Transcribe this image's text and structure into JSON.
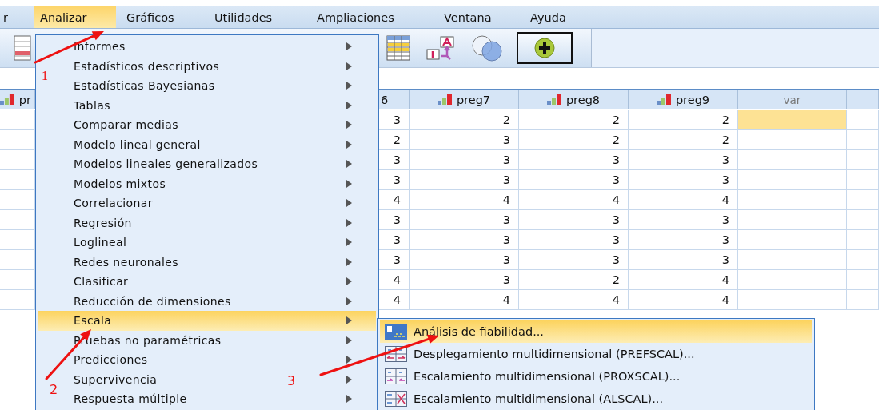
{
  "menu_bar": {
    "items": [
      {
        "label": "r",
        "selected": false
      },
      {
        "label": "Analizar",
        "selected": true
      },
      {
        "label": "Gráficos",
        "selected": false
      },
      {
        "label": "Utilidades",
        "selected": false
      },
      {
        "label": "Ampliaciones",
        "selected": false
      },
      {
        "label": "Ventana",
        "selected": false
      },
      {
        "label": "Ayuda",
        "selected": false
      }
    ]
  },
  "toolbar": {
    "buttons": [
      {
        "kind": "data-view",
        "pressed": false
      },
      {
        "kind": "grid",
        "pressed": false
      },
      {
        "kind": "value-labels",
        "pressed": false
      },
      {
        "kind": "sets",
        "pressed": false
      },
      {
        "kind": "plus",
        "pressed": true
      }
    ]
  },
  "grid": {
    "columns": [
      {
        "label": "pr",
        "kind": "variable"
      },
      {
        "label": "6",
        "kind": "plain"
      },
      {
        "label": "preg7",
        "kind": "variable"
      },
      {
        "label": "preg8",
        "kind": "variable"
      },
      {
        "label": "preg9",
        "kind": "variable"
      },
      {
        "label": "var",
        "kind": "empty"
      }
    ],
    "rows": [
      {
        "values": [
          "3",
          "2",
          "2",
          "2"
        ],
        "selected": true
      },
      {
        "values": [
          "2",
          "3",
          "2",
          "2"
        ],
        "selected": false
      },
      {
        "values": [
          "3",
          "3",
          "3",
          "3"
        ],
        "selected": false
      },
      {
        "values": [
          "3",
          "3",
          "3",
          "3"
        ],
        "selected": false
      },
      {
        "values": [
          "4",
          "4",
          "4",
          "4"
        ],
        "selected": false
      },
      {
        "values": [
          "3",
          "3",
          "3",
          "3"
        ],
        "selected": false
      },
      {
        "values": [
          "3",
          "3",
          "3",
          "3"
        ],
        "selected": false
      },
      {
        "values": [
          "3",
          "3",
          "3",
          "3"
        ],
        "selected": false
      },
      {
        "values": [
          "4",
          "3",
          "2",
          "4"
        ],
        "selected": false
      },
      {
        "values": [
          "4",
          "4",
          "4",
          "4"
        ],
        "selected": false
      }
    ]
  },
  "menu": {
    "items": [
      {
        "label": "Informes",
        "selected": false,
        "has_submenu": true
      },
      {
        "label": "Estadísticos descriptivos",
        "selected": false,
        "has_submenu": true
      },
      {
        "label": "Estadísticas Bayesianas",
        "selected": false,
        "has_submenu": true
      },
      {
        "label": "Tablas",
        "selected": false,
        "has_submenu": true
      },
      {
        "label": "Comparar medias",
        "selected": false,
        "has_submenu": true
      },
      {
        "label": "Modelo lineal general",
        "selected": false,
        "has_submenu": true
      },
      {
        "label": "Modelos lineales generalizados",
        "selected": false,
        "has_submenu": true
      },
      {
        "label": "Modelos mixtos",
        "selected": false,
        "has_submenu": true
      },
      {
        "label": "Correlacionar",
        "selected": false,
        "has_submenu": true
      },
      {
        "label": "Regresión",
        "selected": false,
        "has_submenu": true
      },
      {
        "label": "Loglineal",
        "selected": false,
        "has_submenu": true
      },
      {
        "label": "Redes neuronales",
        "selected": false,
        "has_submenu": true
      },
      {
        "label": "Clasificar",
        "selected": false,
        "has_submenu": true
      },
      {
        "label": "Reducción de dimensiones",
        "selected": false,
        "has_submenu": true
      },
      {
        "label": "Escala",
        "selected": true,
        "has_submenu": true
      },
      {
        "label": "Pruebas no paramétricas",
        "selected": false,
        "has_submenu": true
      },
      {
        "label": "Predicciones",
        "selected": false,
        "has_submenu": true
      },
      {
        "label": "Supervivencia",
        "selected": false,
        "has_submenu": true
      },
      {
        "label": "Respuesta múltiple",
        "selected": false,
        "has_submenu": true
      }
    ]
  },
  "submenu": {
    "items": [
      {
        "label": "Análisis de fiabilidad...",
        "selected": true,
        "kind": "reliability"
      },
      {
        "label": "Desplegamiento multidimensional (PREFSCAL)...",
        "selected": false,
        "kind": "unfolding"
      },
      {
        "label": "Escalamiento multidimensional (PROXSCAL)...",
        "selected": false,
        "kind": "scaling"
      },
      {
        "label": "Escalamiento multidimensional (ALSCAL)...",
        "selected": false,
        "kind": "scaling-alt"
      }
    ]
  },
  "annotations": [
    {
      "label": "1"
    },
    {
      "label": "2"
    },
    {
      "label": "3"
    }
  ]
}
